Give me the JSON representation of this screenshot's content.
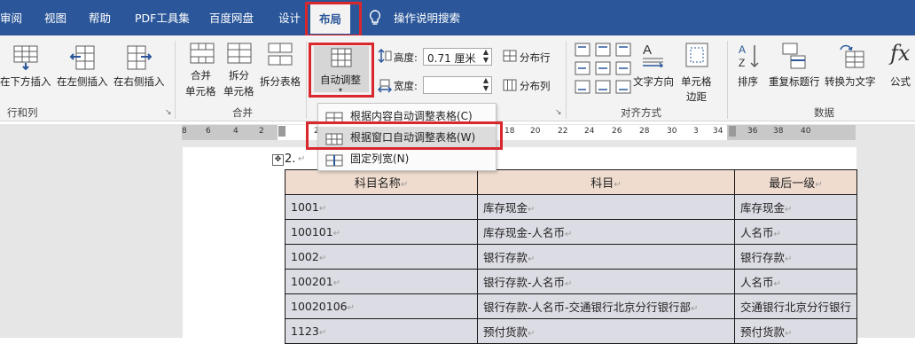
{
  "tabs": [
    {
      "label": "审阅",
      "active": false
    },
    {
      "label": "视图",
      "active": false
    },
    {
      "label": "帮助",
      "active": false
    },
    {
      "label": "PDF工具集",
      "active": false
    },
    {
      "label": "百度网盘",
      "active": false
    },
    {
      "label": "设计",
      "active": false
    },
    {
      "label": "布局",
      "active": true
    }
  ],
  "search": {
    "icon": "lightbulb-icon",
    "label": "操作说明搜索"
  },
  "ribbon": {
    "insert_below": "在下方插入",
    "insert_left": "在左侧插入",
    "insert_right": "在右侧插入",
    "group_rows_cols": "行和列",
    "merge_cells_1": "合并",
    "merge_cells_2": "单元格",
    "split_cells_1": "拆分",
    "split_cells_2": "单元格",
    "split_table": "拆分表格",
    "group_merge": "合并",
    "autofit": "自动调整",
    "height_label": "高度:",
    "height_value": "0.71 厘米",
    "width_label": "宽度:",
    "width_value": "",
    "distribute_rows": "分布行",
    "distribute_cols": "分布列",
    "text_direction": "文字方向",
    "cell_margins_1": "单元格",
    "cell_margins_2": "边距",
    "group_alignment": "对齐方式",
    "sort": "排序",
    "repeat_header": "重复标题行",
    "convert_to_text": "转换为文字",
    "formula": "公式",
    "group_data": "数据"
  },
  "autofit_menu": {
    "items": [
      {
        "label": "根据内容自动调整表格(C)",
        "highlighted": false
      },
      {
        "label": "根据窗口自动调整表格(W)",
        "highlighted": true
      },
      {
        "label": "固定列宽(N)",
        "highlighted": false
      }
    ]
  },
  "ruler": {
    "left_ticks": [
      "8",
      "6",
      "4",
      "2"
    ],
    "right_ticks": [
      "2",
      "18",
      "20",
      "22",
      "24",
      "26",
      "28",
      "30",
      "3",
      "34",
      "36",
      "38",
      "40"
    ]
  },
  "document": {
    "heading": "2.",
    "table": {
      "headers": [
        "科目名称",
        "科目",
        "最后一级"
      ],
      "rows": [
        [
          "1001",
          "库存现金",
          "库存现金"
        ],
        [
          "100101",
          "库存现金-人名币",
          "人名币"
        ],
        [
          "1002",
          "银行存款",
          "银行存款"
        ],
        [
          "100201",
          "银行存款-人名币",
          "人名币"
        ],
        [
          "10020106",
          "银行存款-人名币-交通银行北京分行银行部",
          "交通银行北京分行银行"
        ],
        [
          "1123",
          "预付货款",
          "预付货款"
        ]
      ]
    }
  },
  "colors": {
    "accent": "#2b579a",
    "highlight_box": "#d9272e",
    "header_fill": "#efdccf",
    "cell_fill": "#dcdce4"
  }
}
